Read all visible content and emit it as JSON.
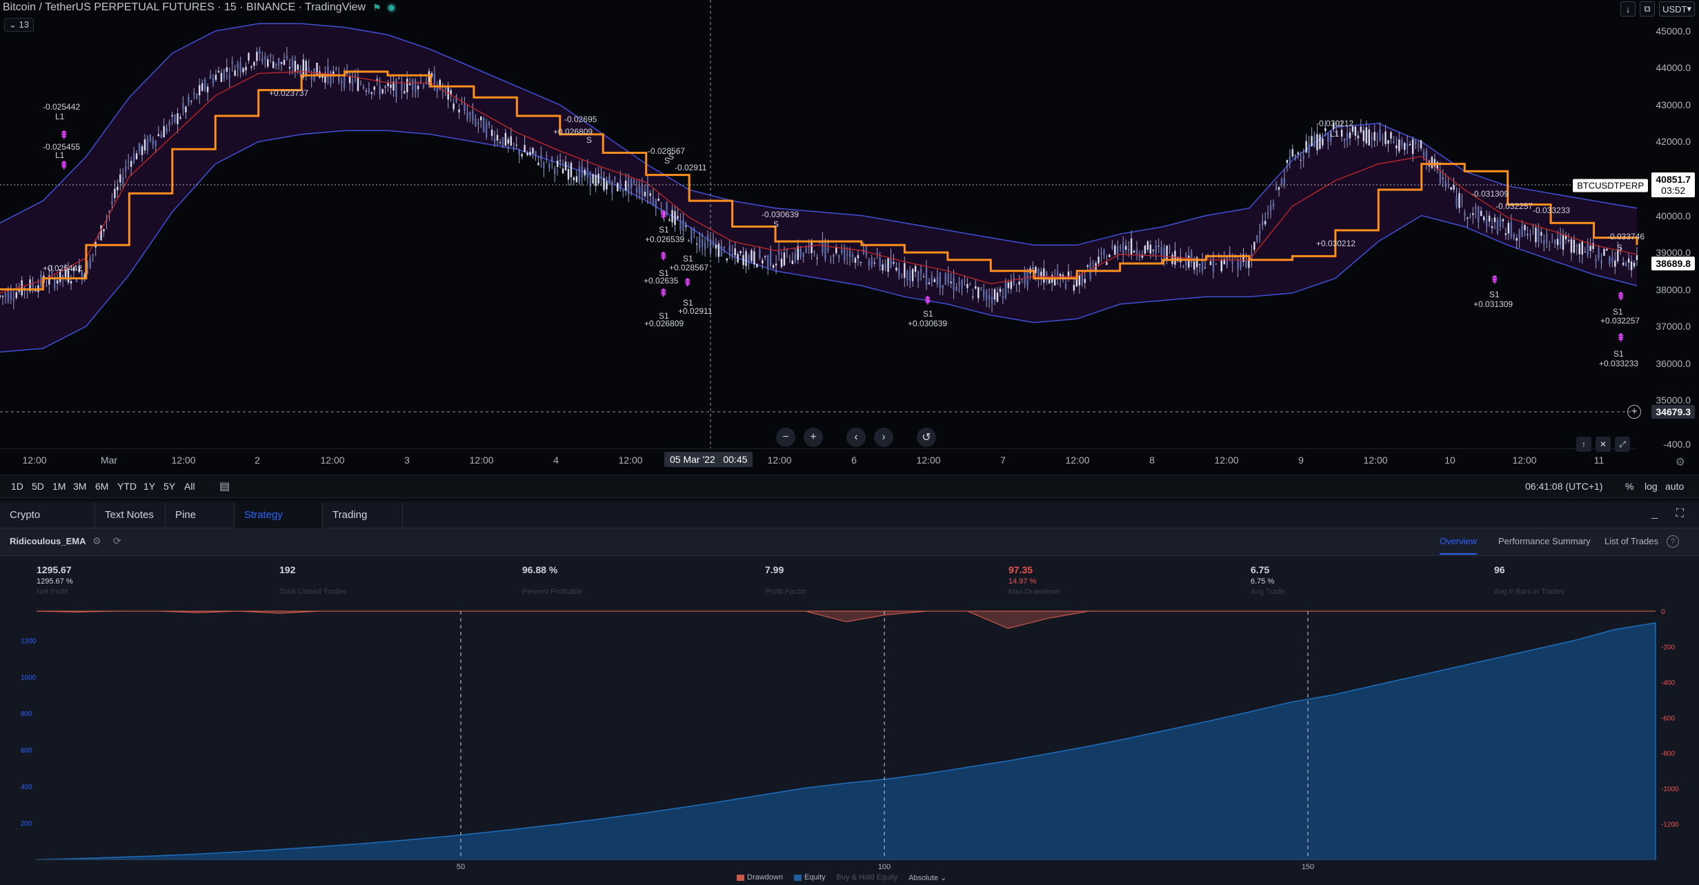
{
  "header": {
    "symbol_title": "Bitcoin / TetherUS PERPETUAL FUTURES · 15 · BINANCE · TradingView",
    "indicator_count": "13",
    "currency": "USDT"
  },
  "price_axis": {
    "ticks": [
      "45000.0",
      "44000.0",
      "43000.0",
      "42000.0",
      "41000.0",
      "40000.0",
      "39000.0",
      "38000.0",
      "37000.0",
      "36000.0",
      "35000.0",
      "-400.0"
    ],
    "last_price": "40851.7",
    "countdown": "03:52",
    "symbol_tag": "BTCUSDTPERP",
    "cross_price": "38689.8",
    "cursor_price": "34679.3"
  },
  "time_axis": {
    "labels": [
      "12:00",
      "Mar",
      "12:00",
      "2",
      "12:00",
      "3",
      "12:00",
      "4",
      "12:00",
      "12:00",
      "6",
      "12:00",
      "7",
      "12:00",
      "8",
      "12:00",
      "9",
      "12:00",
      "10",
      "12:00",
      "11"
    ],
    "crosshair_date": "05 Mar '22",
    "crosshair_time": "00:45"
  },
  "chart_data": {
    "type": "line",
    "title": "Bitcoin / TetherUS PERPETUAL FUTURES · 15 · BINANCE",
    "ylim": [
      34500,
      45400
    ],
    "series": [
      {
        "name": "",
        "values": [
          37800,
          38200,
          38500,
          41500,
          42500,
          43800,
          44300,
          44000,
          43700,
          43400,
          43700,
          42600,
          41800,
          41300,
          40900,
          40700,
          39500,
          38900,
          38800,
          39100,
          38900,
          38500,
          38200,
          37800,
          38400,
          38200,
          39200,
          39000,
          38700,
          38800,
          41600,
          42300,
          42100,
          41800,
          40200,
          39600,
          39400,
          39000,
          38700
        ]
      },
      {
        "name": "",
        "values": [
          38000,
          38300,
          39200,
          40600,
          41800,
          42700,
          43400,
          43800,
          43900,
          43800,
          43500,
          43200,
          42700,
          42200,
          41700,
          41100,
          40400,
          39700,
          39300,
          39300,
          39200,
          39000,
          38800,
          38500,
          38300,
          38500,
          38700,
          38800,
          38900,
          38800,
          38900,
          39600,
          40700,
          41400,
          41200,
          40300,
          39800,
          39400,
          39200
        ]
      }
    ],
    "bands": {
      "upper": [
        39800,
        40400,
        41600,
        43200,
        44400,
        45000,
        45200,
        45200,
        45100,
        44900,
        44500,
        44000,
        43500,
        43000,
        42200,
        41400,
        40700,
        40400,
        40200,
        40100,
        40000,
        39800,
        39600,
        39400,
        39200,
        39200,
        39500,
        39700,
        40000,
        40200,
        41500,
        42400,
        42500,
        42000,
        41200,
        40800,
        40600,
        40400,
        40200
      ],
      "lower": [
        36300,
        36400,
        37000,
        38400,
        40100,
        41400,
        42000,
        42200,
        42300,
        42300,
        42200,
        42000,
        41800,
        41400,
        41000,
        40400,
        39700,
        38900,
        38500,
        38300,
        38100,
        37800,
        37600,
        37300,
        37100,
        37200,
        37600,
        37700,
        37800,
        37800,
        37900,
        38300,
        39300,
        40000,
        39700,
        39200,
        38800,
        38400,
        38100
      ]
    },
    "price_annotations": [
      "-0.025442",
      "L1",
      "-0.025455",
      "L1",
      "+0.025442",
      "+0.023737",
      "-0.02695",
      "+0.026809",
      "S",
      "-0.028567",
      "S",
      "-0.02911",
      "S",
      "S1",
      "+0.026539",
      "S1",
      "+0.028567",
      "S1",
      "+0.02635",
      "S1",
      "+0.02911",
      "S1",
      "+0.026809",
      "-0.030639",
      "S",
      "S1",
      "+0.030639",
      "-0.030212",
      "L1",
      "+0.030212",
      "-0.031309",
      "-0.032257",
      "-0.033233",
      "-0.033746",
      "S",
      "S1",
      "+0.031309",
      "S1",
      "+0.032257",
      "S1",
      "+0.033233"
    ]
  },
  "range_bar": {
    "ranges": [
      "1D",
      "5D",
      "1M",
      "3M",
      "6M",
      "YTD",
      "1Y",
      "5Y",
      "All"
    ],
    "clock": "06:41:08 (UTC+1)",
    "pct": "%",
    "log": "log",
    "auto": "auto"
  },
  "panel_tabs": [
    "Crypto Screener",
    "Text Notes",
    "Pine Editor",
    "Strategy Tester",
    "Trading Panel"
  ],
  "strategy": {
    "name": "Ridicoulous_EMA",
    "report_tabs": [
      "Overview",
      "Performance Summary",
      "List of Trades"
    ],
    "metrics": [
      {
        "value": "1295.67",
        "sub": "1295.67 %",
        "label": "Net Profit"
      },
      {
        "value": "192",
        "sub": "",
        "label": "Total Closed Trades"
      },
      {
        "value": "96.88 %",
        "sub": "",
        "label": "Percent Profitable"
      },
      {
        "value": "7.99",
        "sub": "",
        "label": "Profit Factor"
      },
      {
        "value": "97.35",
        "sub": "14.97 %",
        "label": "Max Drawdown"
      },
      {
        "value": "6.75",
        "sub": "6.75 %",
        "label": "Avg Trade"
      },
      {
        "value": "96",
        "sub": "",
        "label": "Avg # Bars in Trades"
      }
    ],
    "equity_left_ticks": [
      "1200",
      "1000",
      "800",
      "600",
      "400",
      "200"
    ],
    "equity_right_ticks": [
      "0",
      "-200",
      "-400",
      "-600",
      "-800",
      "-1000",
      "-1200"
    ],
    "equity_x_ticks": [
      "50",
      "100",
      "150"
    ],
    "equity_values": [
      0,
      5,
      12,
      20,
      30,
      42,
      55,
      70,
      86,
      104,
      124,
      146,
      170,
      196,
      224,
      254,
      286,
      320,
      356,
      392,
      418,
      440,
      470,
      505,
      540,
      580,
      620,
      665,
      712,
      760,
      810,
      862,
      900,
      950,
      1000,
      1050,
      1100,
      1150,
      1200,
      1260,
      1295.67
    ],
    "drawdown_values": [
      0,
      -5,
      0,
      0,
      -8,
      0,
      -12,
      0,
      0,
      0,
      0,
      0,
      0,
      0,
      0,
      0,
      0,
      0,
      0,
      0,
      -60,
      -20,
      0,
      0,
      -97.35,
      -40,
      0,
      0,
      0,
      0,
      0,
      0,
      0,
      0,
      0,
      0,
      0,
      0,
      0,
      0,
      0
    ],
    "legend": [
      "Drawdown",
      "Equity",
      "Buy & Hold Equity",
      "Absolute"
    ],
    "colors": {
      "equity": "#1e5fa0",
      "drawdown": "#c8594a"
    }
  }
}
